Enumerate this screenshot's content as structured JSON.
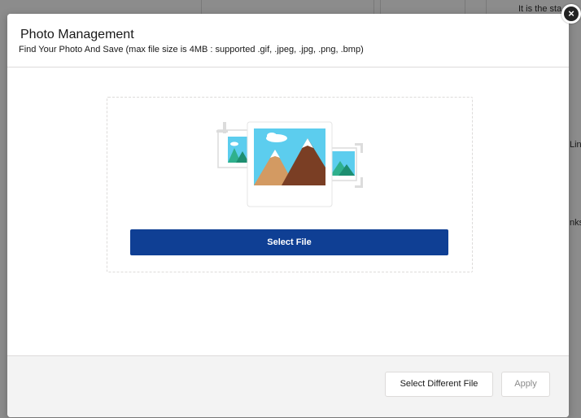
{
  "background": {
    "snippets": [
      "It is the sta",
      "Lin",
      "nks"
    ]
  },
  "modal": {
    "title": "Photo Management",
    "subtitle": "Find Your Photo And Save (max file size is 4MB : supported .gif, .jpeg, .jpg, .png, .bmp)",
    "select_file_label": "Select File",
    "select_different_label": "Select Different File",
    "apply_label": "Apply",
    "close_glyph": "×"
  },
  "colors": {
    "primary_button": "#0f3f94",
    "sky": "#5ccdee",
    "mountain_left": "#d39a62",
    "mountain_right": "#7a3e24",
    "green_hill": "#2fb08d"
  },
  "icons": {
    "close": "close-icon",
    "illustration": "photo-gallery-icon"
  }
}
